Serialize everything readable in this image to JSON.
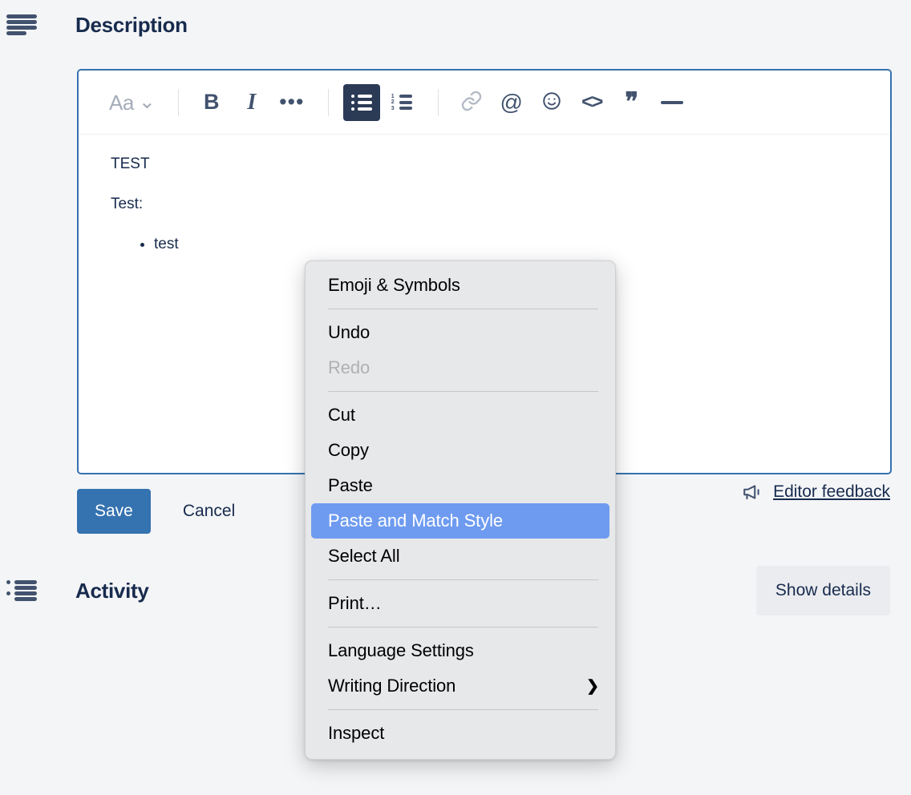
{
  "description_section": {
    "icon": "description-lines-icon",
    "title": "Description"
  },
  "editor": {
    "toolbar": {
      "text_style_label": "Aa",
      "chevron": "⌄",
      "bold_label": "B",
      "italic_label": "I",
      "more_label": "•••",
      "at_label": "@",
      "emoji_label": "☺",
      "code_label": "<>",
      "quote_label": "❞",
      "ordered_numbers": [
        "1",
        "2",
        "3"
      ]
    },
    "content": {
      "paragraphs": [
        "TEST",
        "Test:"
      ],
      "bullets": [
        "test"
      ]
    },
    "border_color": "#3572b0"
  },
  "actions": {
    "save_label": "Save",
    "cancel_label": "Cancel",
    "save_bg": "#3572b0",
    "feedback_label": "Editor feedback",
    "feedback_icon": "megaphone-icon"
  },
  "activity_section": {
    "icon": "activity-list-icon",
    "title": "Activity",
    "show_details_label": "Show details"
  },
  "context_menu": {
    "highlight_color": "#6e9bf0",
    "background": "#e7e8ea",
    "items": [
      {
        "label": "Emoji & Symbols",
        "state": "normal",
        "submenu": false
      },
      {
        "separator": true
      },
      {
        "label": "Undo",
        "state": "normal",
        "submenu": false
      },
      {
        "label": "Redo",
        "state": "disabled",
        "submenu": false
      },
      {
        "separator": true
      },
      {
        "label": "Cut",
        "state": "normal",
        "submenu": false
      },
      {
        "label": "Copy",
        "state": "normal",
        "submenu": false
      },
      {
        "label": "Paste",
        "state": "normal",
        "submenu": false
      },
      {
        "label": "Paste and Match Style",
        "state": "selected",
        "submenu": false
      },
      {
        "label": "Select All",
        "state": "normal",
        "submenu": false
      },
      {
        "separator": true
      },
      {
        "label": "Print…",
        "state": "normal",
        "submenu": false
      },
      {
        "separator": true
      },
      {
        "label": "Language Settings",
        "state": "normal",
        "submenu": false
      },
      {
        "label": "Writing Direction",
        "state": "normal",
        "submenu": true,
        "arrow": "❯"
      },
      {
        "separator": true
      },
      {
        "label": "Inspect",
        "state": "normal",
        "submenu": false
      }
    ]
  }
}
